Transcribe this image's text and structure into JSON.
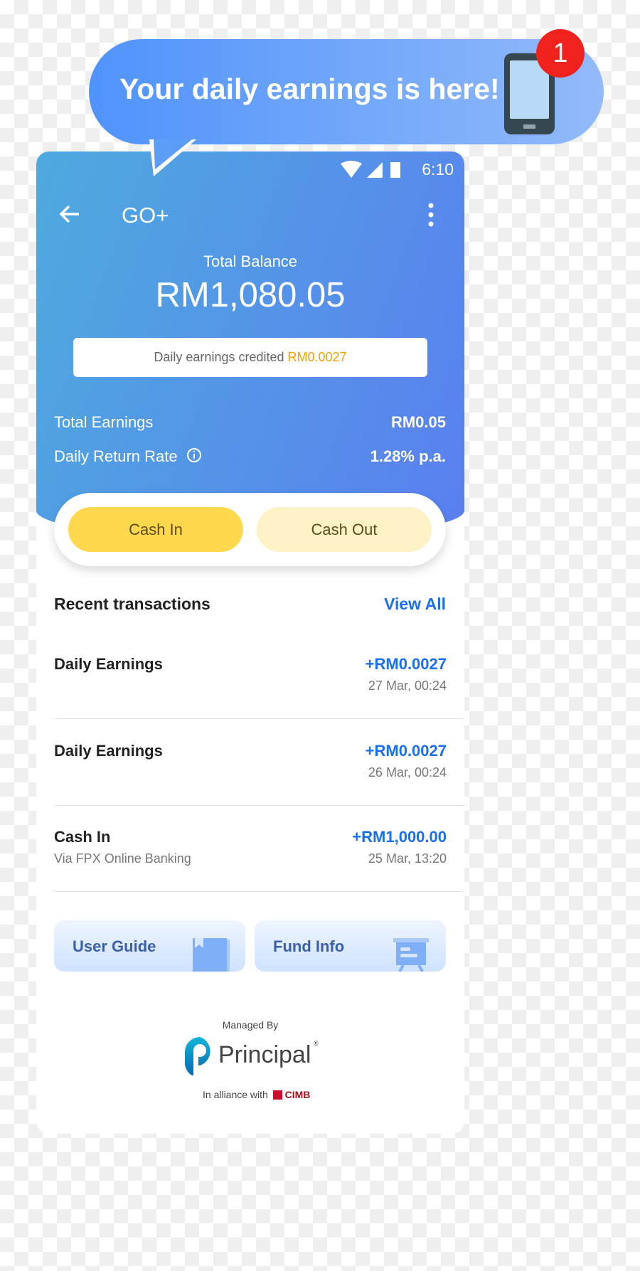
{
  "notification": {
    "message": "Your daily earnings is here!",
    "badge_count": "1"
  },
  "status_bar": {
    "time": "6:10"
  },
  "header": {
    "title": "GO+"
  },
  "balance": {
    "label": "Total Balance",
    "amount": "RM1,080.05"
  },
  "daily_banner": {
    "label": "Daily earnings credited",
    "amount": "RM0.0027"
  },
  "stats": [
    {
      "label": "Total Earnings",
      "value": "RM0.05"
    },
    {
      "label": "Daily Return Rate",
      "value": "1.28% p.a."
    }
  ],
  "actions": {
    "cash_in": "Cash In",
    "cash_out": "Cash Out"
  },
  "recent": {
    "title": "Recent transactions",
    "view_all": "View All",
    "items": [
      {
        "title": "Daily Earnings",
        "subtitle": "",
        "amount": "+RM0.0027",
        "date": "27 Mar, 00:24"
      },
      {
        "title": "Daily Earnings",
        "subtitle": "",
        "amount": "+RM0.0027",
        "date": "26 Mar, 00:24"
      },
      {
        "title": "Cash In",
        "subtitle": "Via FPX Online Banking",
        "amount": "+RM1,000.00",
        "date": "25 Mar, 13:20"
      }
    ]
  },
  "links": {
    "user_guide": "User Guide",
    "fund_info": "Fund Info"
  },
  "footer": {
    "managed_by": "Managed By",
    "brand": "Principal",
    "alliance": "In alliance with",
    "partner": "CIMB"
  },
  "colors": {
    "accent": "#1a6ff0",
    "highlight": "#f5a000",
    "cash_in": "#ffd84d",
    "cash_out": "#fff2c6",
    "badge": "#f0221d"
  }
}
